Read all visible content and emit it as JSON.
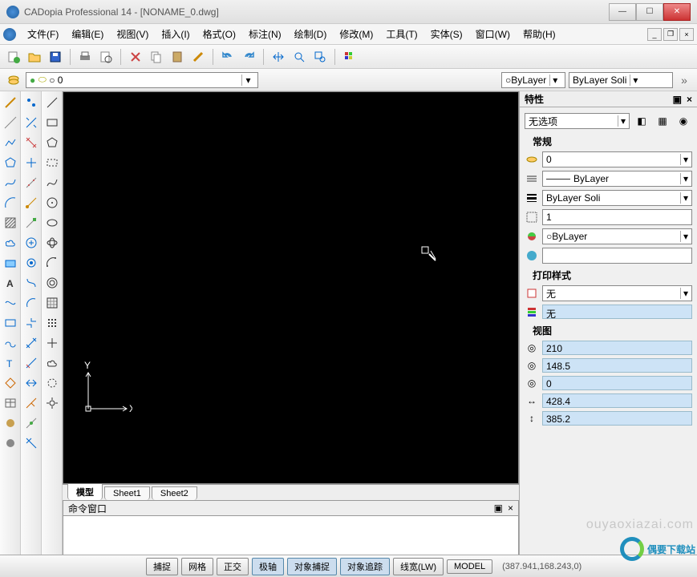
{
  "titlebar": {
    "title": "CADopia Professional 14 - [NONAME_0.dwg]"
  },
  "menu": {
    "items": [
      "文件(F)",
      "编辑(E)",
      "视图(V)",
      "插入(I)",
      "格式(O)",
      "标注(N)",
      "绘制(D)",
      "修改(M)",
      "工具(T)",
      "实体(S)",
      "窗口(W)",
      "帮助(H)"
    ]
  },
  "layerbar": {
    "current_layer": "0",
    "color_select": "ByLayer",
    "ltype_select": "ByLayer   Soli"
  },
  "canvas": {
    "axis_x": "X",
    "axis_y": "Y"
  },
  "tabs": {
    "items": [
      "模型",
      "Sheet1",
      "Sheet2"
    ],
    "active": 0
  },
  "cmd": {
    "header": "命令窗口"
  },
  "props": {
    "title": "特性",
    "selection": "无选项",
    "sections": {
      "general": "常规",
      "printstyle": "打印样式",
      "view": "视图"
    },
    "general": {
      "layer": "0",
      "linetype": "ByLayer",
      "lineweight": "ByLayer   Soli",
      "scale": "1",
      "color": "ByLayer"
    },
    "printstyle": {
      "style": "无",
      "value2": "无"
    },
    "view": {
      "v1": "210",
      "v2": "148.5",
      "v3": "0",
      "v4": "428.4",
      "v5": "385.2"
    }
  },
  "status": {
    "buttons": [
      "捕捉",
      "网格",
      "正交",
      "极轴",
      "对象捕捉",
      "对象追踪",
      "线宽(LW)",
      "MODEL"
    ],
    "active": [
      3,
      4,
      5
    ],
    "coords": "(387.941,168.243,0)"
  },
  "watermark": "ouyaoxiazai.com",
  "logo_text": "偶要下载站"
}
